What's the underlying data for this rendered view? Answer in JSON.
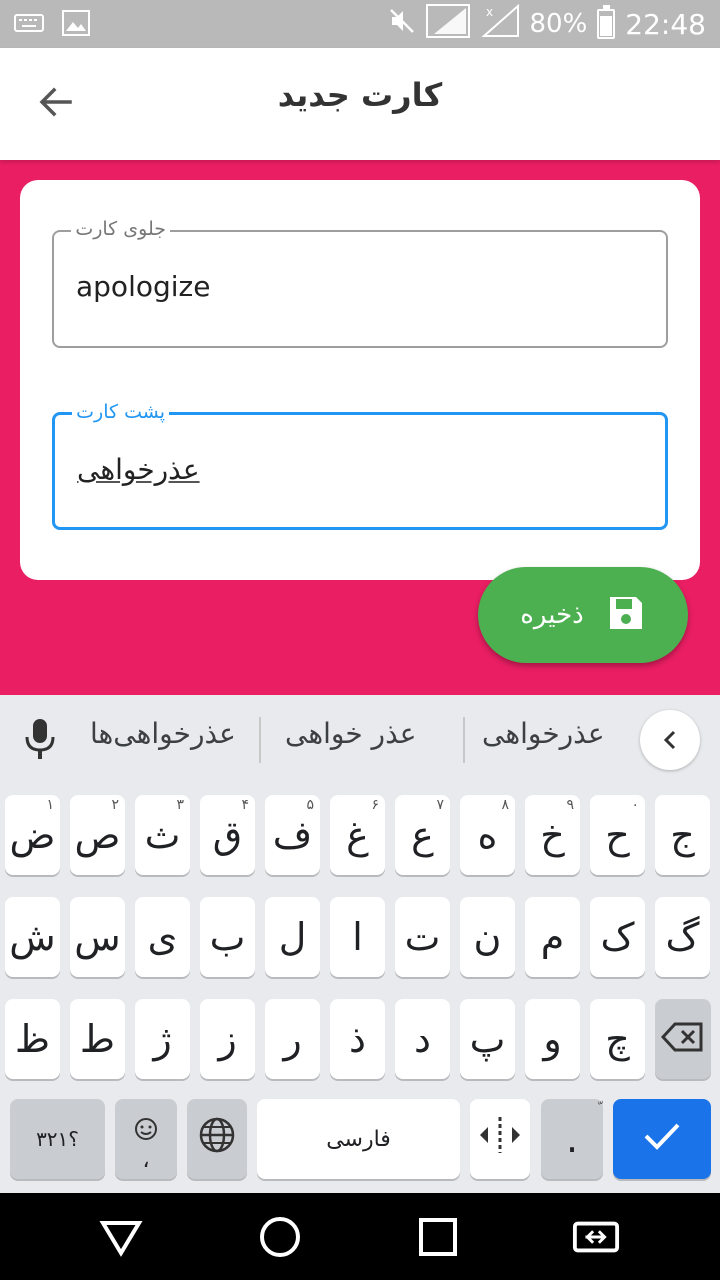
{
  "statusbar": {
    "battery": "80%",
    "time": "22:48",
    "left_icons": [
      "keyboard-icon",
      "image-icon"
    ],
    "right_icons": [
      "mute-icon",
      "signal-sim1-icon",
      "signal-no-service-icon",
      "battery-icon"
    ]
  },
  "appbar": {
    "title": "کارت جدید",
    "back_icon": "arrow-back-icon"
  },
  "form": {
    "front": {
      "label": "جلوی کارت",
      "value": "apologize"
    },
    "back": {
      "label": "پشت کارت",
      "value": "عذرخواهی"
    }
  },
  "fab": {
    "label": "ذخیره",
    "icon": "save-icon"
  },
  "keyboard": {
    "suggestions": [
      "عذرخواهی",
      "عذر خواهی",
      "عذرخواهی‌ها"
    ],
    "row1": [
      {
        "k": "ج",
        "h": ""
      },
      {
        "k": "ح",
        "h": "۰"
      },
      {
        "k": "خ",
        "h": "۹"
      },
      {
        "k": "ه",
        "h": "۸"
      },
      {
        "k": "ع",
        "h": "۷"
      },
      {
        "k": "غ",
        "h": "۶"
      },
      {
        "k": "ف",
        "h": "۵"
      },
      {
        "k": "ق",
        "h": "۴"
      },
      {
        "k": "ث",
        "h": "۳"
      },
      {
        "k": "ص",
        "h": "۲"
      },
      {
        "k": "ض",
        "h": "۱"
      }
    ],
    "row2": [
      "گ",
      "ک",
      "م",
      "ن",
      "ت",
      "ا",
      "ل",
      "ب",
      "ی",
      "س",
      "ش"
    ],
    "row3": [
      "چ",
      "و",
      "پ",
      "د",
      "ذ",
      "ر",
      "ز",
      "ژ",
      "ط",
      "ظ"
    ],
    "bottom": {
      "symbols_label": "؟۳۲۱",
      "comma_label": "،",
      "space_label": "فارسی",
      "period_label": ".",
      "period_hint": "ّ"
    },
    "accent_color": "#1a73e8"
  },
  "colors": {
    "background": "#e91e63",
    "fab": "#4caf50",
    "focus": "#2196f3"
  }
}
